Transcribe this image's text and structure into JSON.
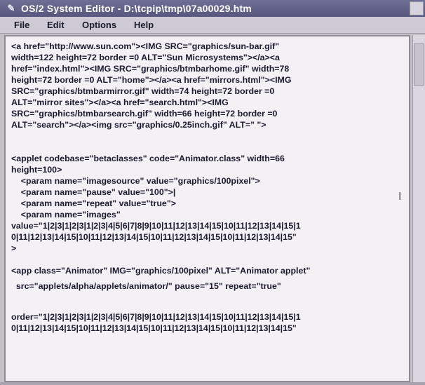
{
  "window": {
    "title": "OS/2 System Editor - D:\\tcpip\\tmp\\07a00029.htm",
    "system_menu_icon": "editor-icon"
  },
  "menu": {
    "items": [
      {
        "label": "File"
      },
      {
        "label": "Edit"
      },
      {
        "label": "Options"
      },
      {
        "label": "Help"
      }
    ]
  },
  "editor": {
    "lines": [
      "<a href=\"http://www.sun.com\"><IMG SRC=\"graphics/sun-bar.gif\"",
      "width=122 height=72 border =0 ALT=\"Sun Microsystems\"></a><a",
      "href=\"index.html\"><IMG SRC=\"graphics/btmbarhome.gif\" width=78",
      "height=72 border =0 ALT=\"home\"></a><a href=\"mirrors.html\"><IMG",
      "SRC=\"graphics/btmbarmirror.gif\" width=74 height=72 border =0",
      "ALT=\"mirror sites\"></a><a href=\"search.html\"><IMG",
      "SRC=\"graphics/btmbarsearch.gif\" width=66 height=72 border =0",
      "ALT=\"search\"></a><img src=\"graphics/0.25inch.gif\" ALT=\" \">",
      "",
      "<applet codebase=\"betaclasses\" code=\"Animator.class\" width=66",
      "height=100>",
      "    <param name=\"imagesource\" value=\"graphics/100pixel\">",
      "    <param name=\"pause\" value=\"100\">|",
      "    <param name=\"repeat\" value=\"true\">",
      "    <param name=\"images\"",
      "value=\"1|2|3|1|2|3|1|2|3|4|5|6|7|8|9|10|11|12|13|14|15|10|11|12|13|14|15|1",
      "0|11|12|13|14|15|10|11|12|13|14|15|10|11|12|13|14|15|10|11|12|13|14|15\"",
      ">",
      "",
      "<app class=\"Animator\" IMG=\"graphics/100pixel\" ALT=\"Animator applet\"",
      "  src=\"applets/alpha/applets/animator/\" pause=\"15\" repeat=\"true\"",
      "",
      "order=\"1|2|3|1|2|3|1|2|3|4|5|6|7|8|9|10|11|12|13|14|15|10|11|12|13|14|15|1",
      "0|11|12|13|14|15|10|11|12|13|14|15|10|11|12|13|14|15|10|11|12|13|14|15\""
    ]
  },
  "colors": {
    "titlebar": "#5f5f88",
    "editor_bg": "#f3f1f5",
    "text": "#1b1b2e"
  }
}
